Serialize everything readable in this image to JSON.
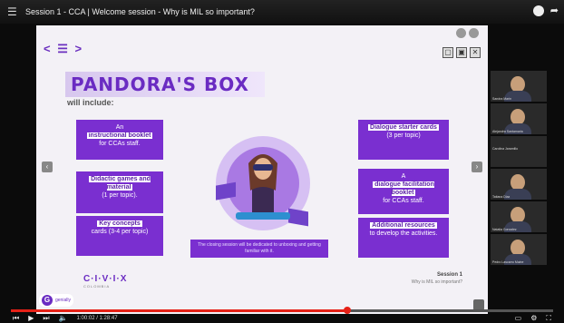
{
  "topbar": {
    "title": "Session 1 - CCA | Welcome session - Why is MIL so important?",
    "menu_icon": "☰",
    "share_icon": "➦"
  },
  "slide": {
    "nav": "< ☰ >",
    "window_buttons": [
      "▢",
      "▣",
      "✕"
    ],
    "title": "PANDORA'S BOX",
    "subtitle": "will include:",
    "cards": {
      "c1": {
        "line1": "An",
        "bold": "instructional booklet",
        "line3": "for CCAs staff."
      },
      "c2": {
        "bold": "Didactic games and material",
        "line3": "(1 per topic)."
      },
      "c3": {
        "bold": "Key concepts",
        "line3": "cards (3-4 per topic)"
      },
      "c4": {
        "bold": "Dialogue starter cards",
        "line3": "(3 per topic)"
      },
      "c5": {
        "line1": "A",
        "bold": "dialogue facilitation booklet",
        "line3": "for CCAs staff."
      },
      "c6": {
        "bold": "Additional resources",
        "line3": "to develop the activities."
      }
    },
    "banner": "The closing session will be dedicated to unboxing and getting familiar with it.",
    "logo": {
      "main": "C·I·V·I·X",
      "sub": "COLOMBIA"
    },
    "session": {
      "line1": "Session 1",
      "line2": "Why is MIL so important?"
    },
    "genially": {
      "mark": "G",
      "text": "genially"
    }
  },
  "participants": [
    {
      "name": "Sandra Marin"
    },
    {
      "name": "Alejandra Santamaria"
    },
    {
      "name": "Carolina Jaramillo"
    },
    {
      "name": "Tatiana Diaz"
    },
    {
      "name": "Natalia Gonzalez"
    },
    {
      "name": "Pedro Lascarro Maine"
    }
  ],
  "controls": {
    "time": "1:00:02 / 1:28:47",
    "progress_fraction": 0.62
  }
}
